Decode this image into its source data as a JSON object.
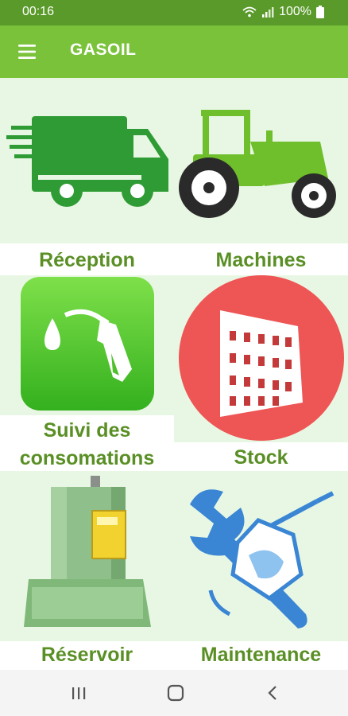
{
  "status": {
    "time": "00:16",
    "battery": "100%"
  },
  "app": {
    "title": "GASOIL"
  },
  "colors": {
    "app_bar": "#79c23a",
    "status_bar": "#5a9a2a",
    "label": "#5a8f25",
    "tile_bg": "#e8f7e3"
  },
  "tiles": [
    {
      "label": "Réception",
      "icon": "delivery-truck-icon"
    },
    {
      "label": "Machines",
      "icon": "tractor-icon"
    },
    {
      "label": "Suivi des consomations",
      "label_line1": "Suivi des",
      "label_line2": "consomations",
      "icon": "fuel-nozzle-icon"
    },
    {
      "label": "Stock",
      "icon": "building-icon"
    },
    {
      "label": "Réservoir",
      "icon": "fuel-tank-icon"
    },
    {
      "label": "Maintenance",
      "icon": "wrench-fuel-icon"
    }
  ],
  "nav": {
    "recents": "recent-apps-icon",
    "home": "home-icon",
    "back": "back-icon"
  }
}
